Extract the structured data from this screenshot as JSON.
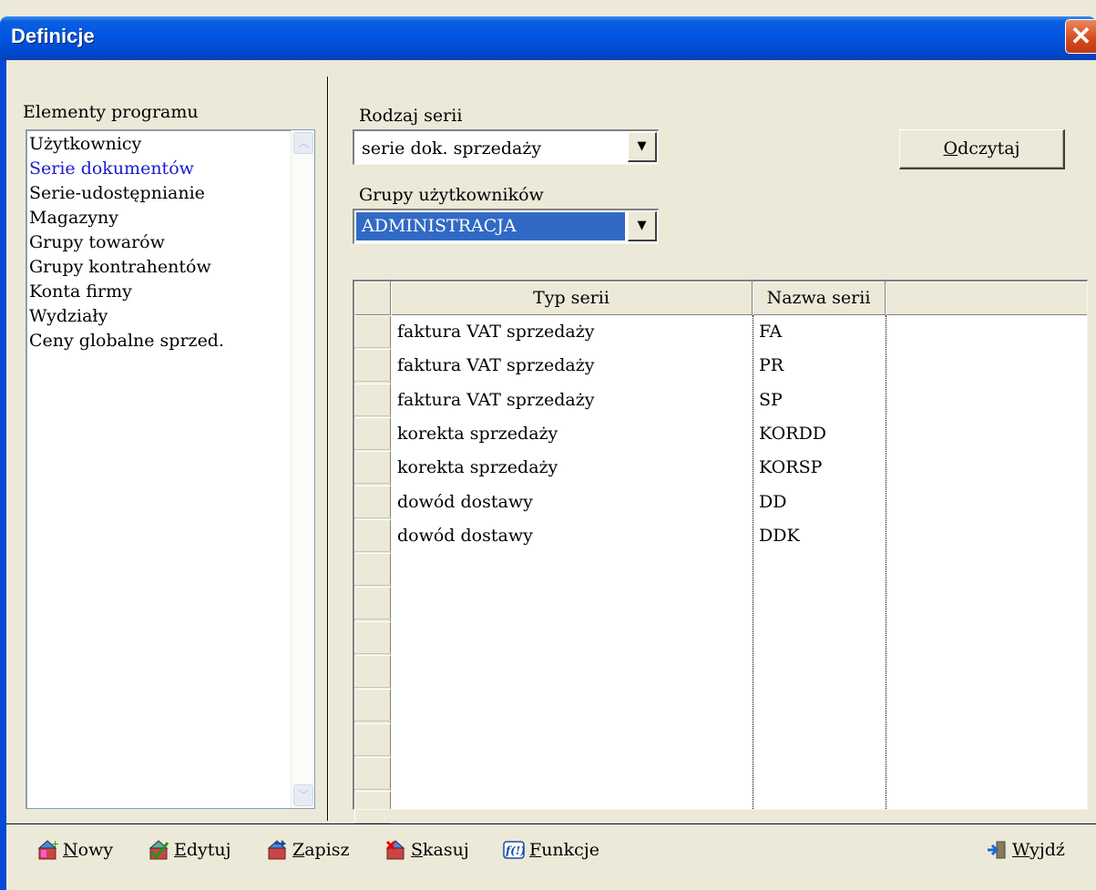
{
  "window": {
    "title": "Definicje"
  },
  "left_panel": {
    "label": "Elementy programu",
    "items": [
      {
        "label": "Użytkownicy",
        "selected": false
      },
      {
        "label": "Serie dokumentów",
        "selected": true
      },
      {
        "label": "Serie-udostępnianie",
        "selected": false
      },
      {
        "label": "Magazyny",
        "selected": false
      },
      {
        "label": "Grupy towarów",
        "selected": false
      },
      {
        "label": "Grupy kontrahentów",
        "selected": false
      },
      {
        "label": "Konta firmy",
        "selected": false
      },
      {
        "label": "Wydziały",
        "selected": false
      },
      {
        "label": "Ceny globalne sprzed.",
        "selected": false
      }
    ]
  },
  "rodzaj_serii": {
    "label": "Rodzaj serii",
    "value": "serie dok. sprzedaży"
  },
  "grupy_uzytkownikow": {
    "label": "Grupy użytkowników",
    "value": "ADMINISTRACJA"
  },
  "odczytaj_button": {
    "label_first": "O",
    "label_rest": "dczytaj"
  },
  "grid": {
    "columns": [
      "Typ serii",
      "Nazwa serii",
      ""
    ],
    "rows": [
      {
        "typ": "faktura VAT sprzedaży",
        "nazwa": "FA"
      },
      {
        "typ": "faktura VAT sprzedaży",
        "nazwa": "PR"
      },
      {
        "typ": "faktura VAT sprzedaży",
        "nazwa": "SP"
      },
      {
        "typ": "korekta sprzedaży",
        "nazwa": "KORDD"
      },
      {
        "typ": "korekta sprzedaży",
        "nazwa": "KORSP"
      },
      {
        "typ": "dowód dostawy",
        "nazwa": "DD"
      },
      {
        "typ": "dowód dostawy",
        "nazwa": "DDK"
      }
    ]
  },
  "toolbar": {
    "nowy": {
      "first": "N",
      "rest": "owy",
      "icon": "new-icon"
    },
    "edytuj": {
      "first": "E",
      "rest": "dytuj",
      "icon": "edit-icon"
    },
    "zapisz": {
      "first": "Z",
      "rest": "apisz",
      "icon": "save-icon"
    },
    "skasuj": {
      "first": "S",
      "rest": "kasuj",
      "icon": "delete-icon"
    },
    "funkcje": {
      "first": "F",
      "rest": "unkcje",
      "icon": "functions-icon",
      "icon_text": "f(!)"
    },
    "wyjdz": {
      "first": "W",
      "rest": "yjdź",
      "icon": "exit-icon"
    }
  },
  "colors": {
    "selection": "#316ac5",
    "titlebar": "#0054e3",
    "selected_item": "#1a1ad0"
  }
}
